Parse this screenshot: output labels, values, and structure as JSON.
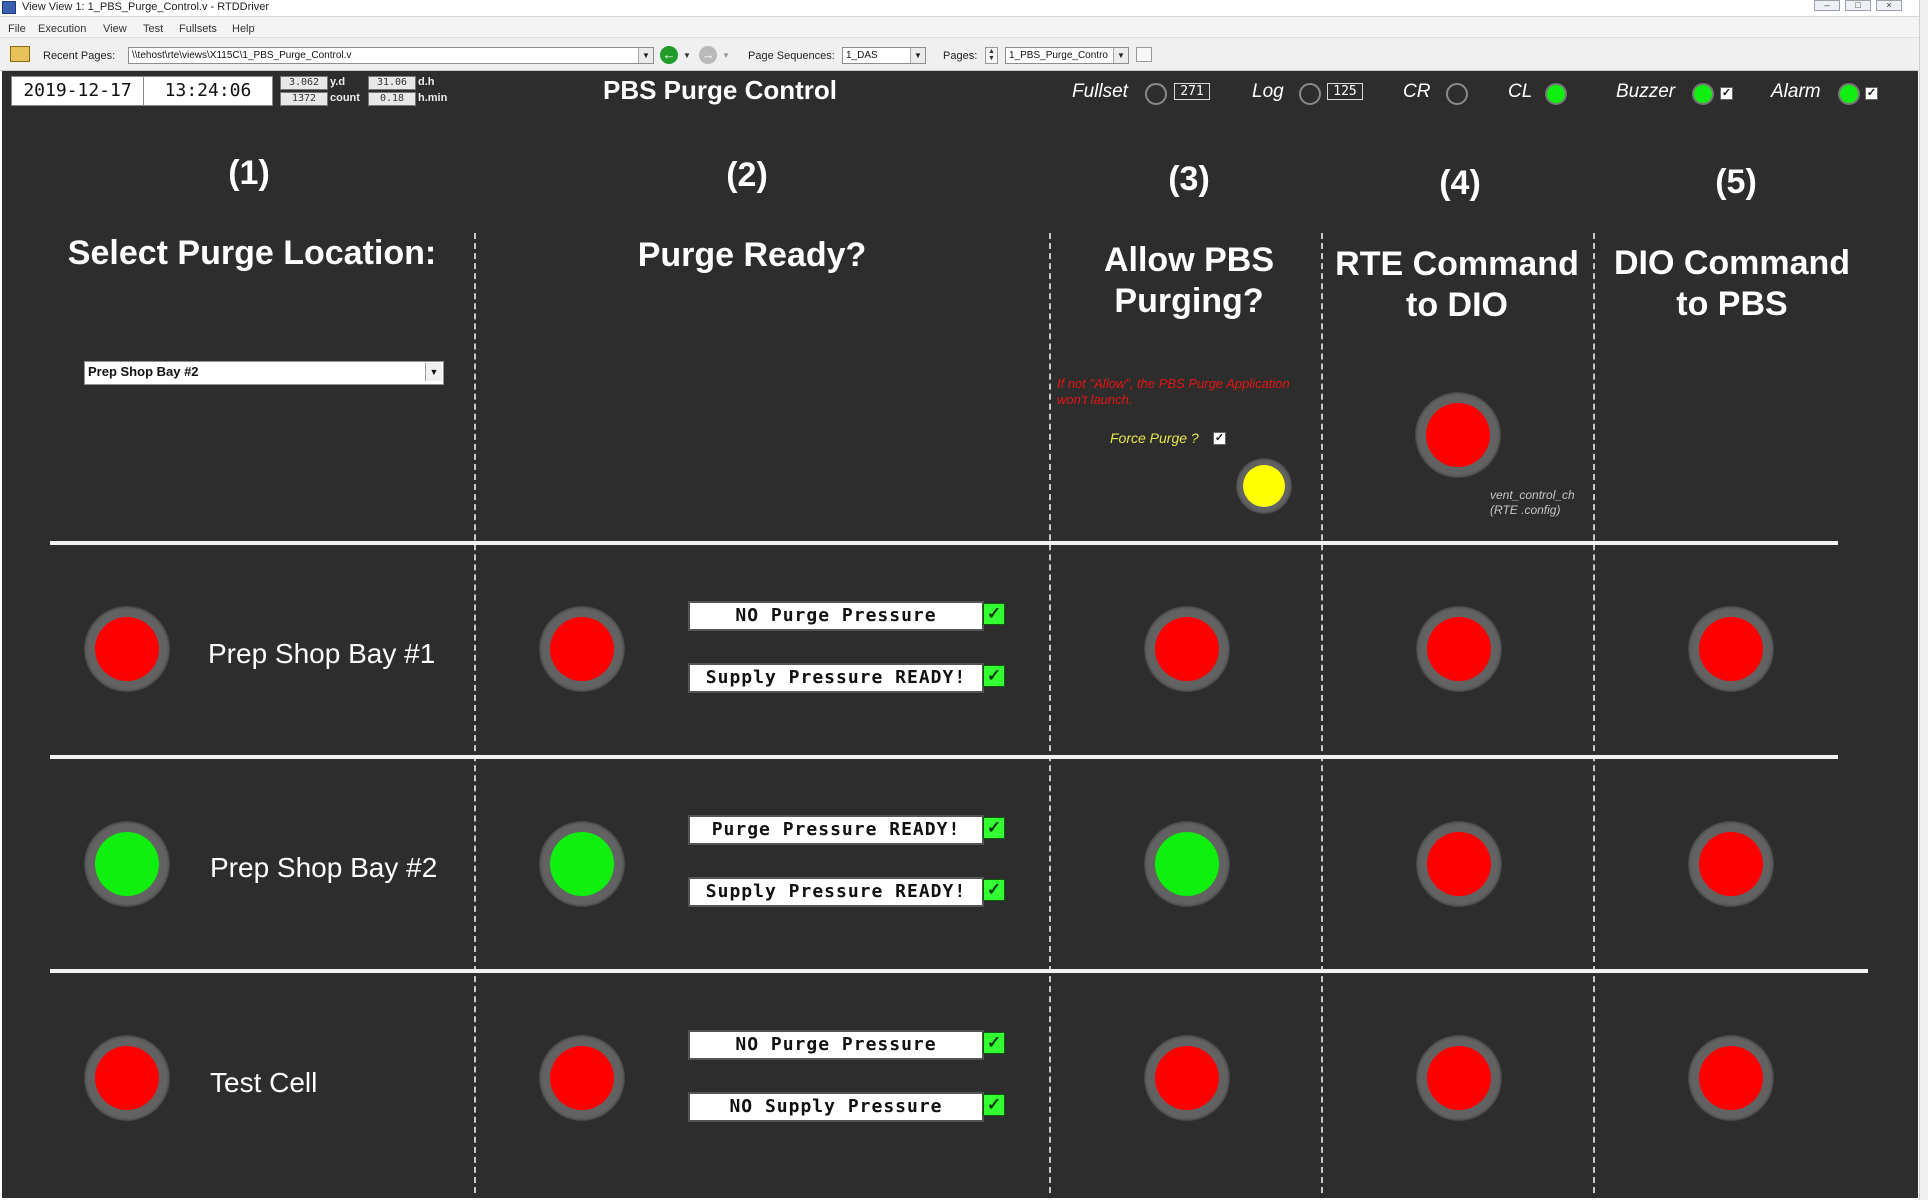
{
  "window": {
    "title": "View View 1: 1_PBS_Purge_Control.v - RTDDriver"
  },
  "menu": [
    "File",
    "Execution",
    "View",
    "Test",
    "Fullsets",
    "Help"
  ],
  "toolbar": {
    "recent_pages_label": "Recent Pages:",
    "recent_pages_value": "\\\\tehost\\rte\\views\\X115C\\1_PBS_Purge_Control.v",
    "page_sequences_label": "Page Sequences:",
    "page_sequences_value": "1_DAS",
    "pages_label": "Pages:",
    "pages_value": "1_PBS_Purge_Contro"
  },
  "header": {
    "date": "2019-12-17",
    "time": "13:24:06",
    "yd_value": "3.062",
    "yd_label": "y.d",
    "count_value": "1372",
    "count_label": "count",
    "dh_value": "31.06",
    "dh_label": "d.h",
    "hmin_value": "0.18",
    "hmin_label": "h.min",
    "title": "PBS Purge Control",
    "fullset_label": "Fullset",
    "fullset_value": "271",
    "log_label": "Log",
    "log_value": "125",
    "cr_label": "CR",
    "cl_label": "CL",
    "buzzer_label": "Buzzer",
    "alarm_label": "Alarm"
  },
  "columns": [
    {
      "number": "(1)",
      "heading": "Select Purge Location:"
    },
    {
      "number": "(2)",
      "heading": "Purge Ready?"
    },
    {
      "number": "(3)",
      "heading": "Allow PBS Purging?"
    },
    {
      "number": "(4)",
      "heading": "RTE Command to DIO"
    },
    {
      "number": "(5)",
      "heading": "DIO Command to PBS"
    }
  ],
  "location_select": {
    "value": "Prep Shop Bay #2"
  },
  "notes": {
    "allow_warning": "If not \"Allow\", the PBS Purge Application won't launch.",
    "force_purge_label": "Force Purge ?",
    "vent_channel": "vent_control_ch",
    "vent_config": "(RTE .config)"
  },
  "top_lamps": {
    "force_purge": "yellow",
    "rte_command": "red"
  },
  "rows": [
    {
      "label": "Prep Shop Bay #1",
      "location": "red",
      "purge_ready": "red",
      "purge_status": "NO Purge Pressure",
      "supply_status": "Supply Pressure READY!",
      "allow": "red",
      "rte_to_dio": "red",
      "dio_to_pbs": "red"
    },
    {
      "label": "Prep Shop Bay #2",
      "location": "green",
      "purge_ready": "green",
      "purge_status": "Purge Pressure READY!",
      "supply_status": "Supply Pressure READY!",
      "allow": "green",
      "rte_to_dio": "red",
      "dio_to_pbs": "red"
    },
    {
      "label": "Test Cell",
      "location": "red",
      "purge_ready": "red",
      "purge_status": "NO Purge Pressure",
      "supply_status": "NO Supply Pressure",
      "allow": "red",
      "rte_to_dio": "red",
      "dio_to_pbs": "red"
    }
  ]
}
